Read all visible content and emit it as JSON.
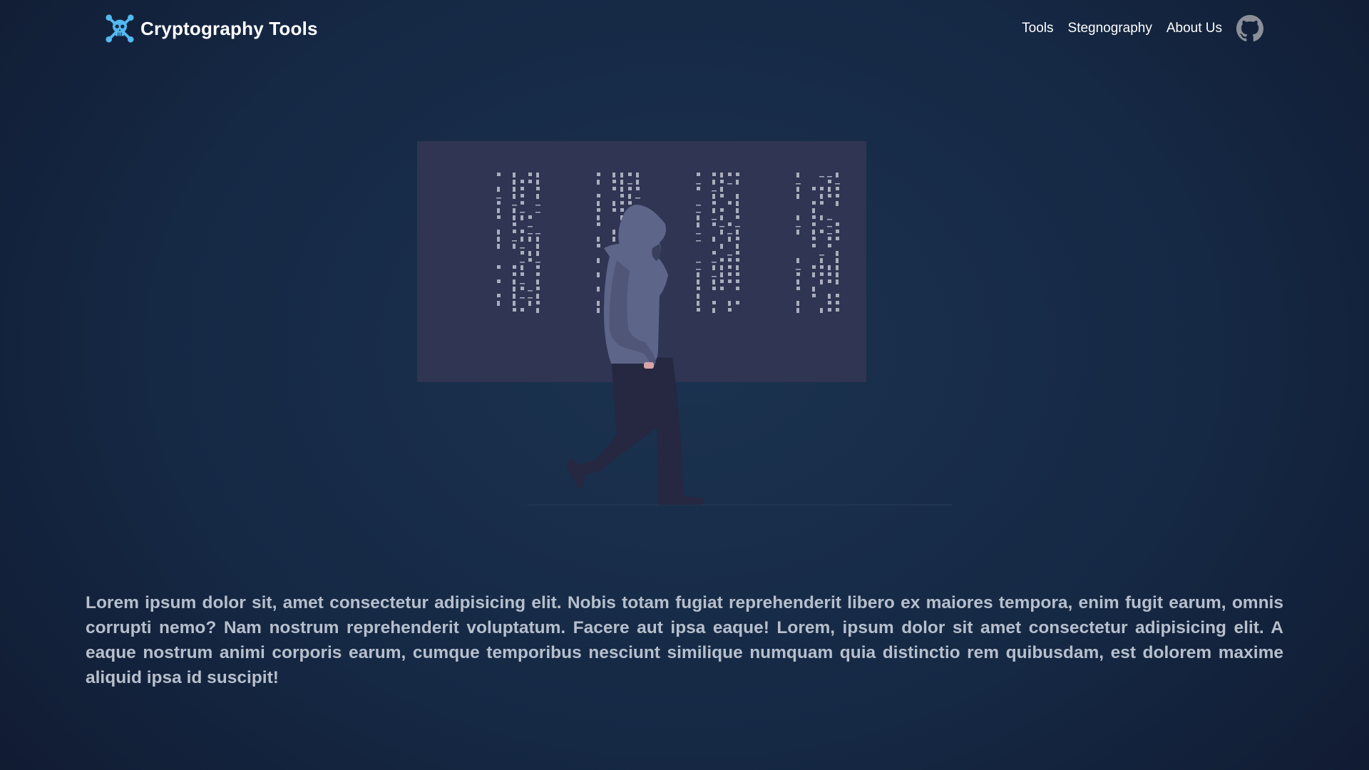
{
  "navbar": {
    "brand": {
      "logo_icon": "skull-crossed-wrenches-icon",
      "title": "Cryptography Tools"
    },
    "links": [
      {
        "label": "Tools"
      },
      {
        "label": "Stegnography"
      },
      {
        "label": "About Us"
      }
    ],
    "github_icon": "github-icon"
  },
  "hero": {
    "illustration": "hooded-figure-walking-past-code-screen"
  },
  "content": {
    "intro_text": "Lorem ipsum dolor sit, amet consectetur adipisicing elit. Nobis totam fugiat reprehenderit libero ex maiores tempora, enim fugit earum, omnis corrupti nemo? Nam nostrum reprehenderit voluptatum. Facere aut ipsa eaque! Lorem, ipsum dolor sit amet consectetur adipisicing elit. A eaque nostrum animi corporis earum, cumque temporibus nesciunt similique numquam quia distinctio rem quibusdam, est dolorem maxime aliquid ipsa id suscipit!"
  },
  "colors": {
    "background": "#152844",
    "brand_accent": "#53b9f2",
    "screen_panel": "#2f3552",
    "code_glyphs": "#a9adbe",
    "hoodie": "#5d6589",
    "pants": "#252840",
    "body_text": "#b7bfcc",
    "nav_text": "#ffffff"
  }
}
